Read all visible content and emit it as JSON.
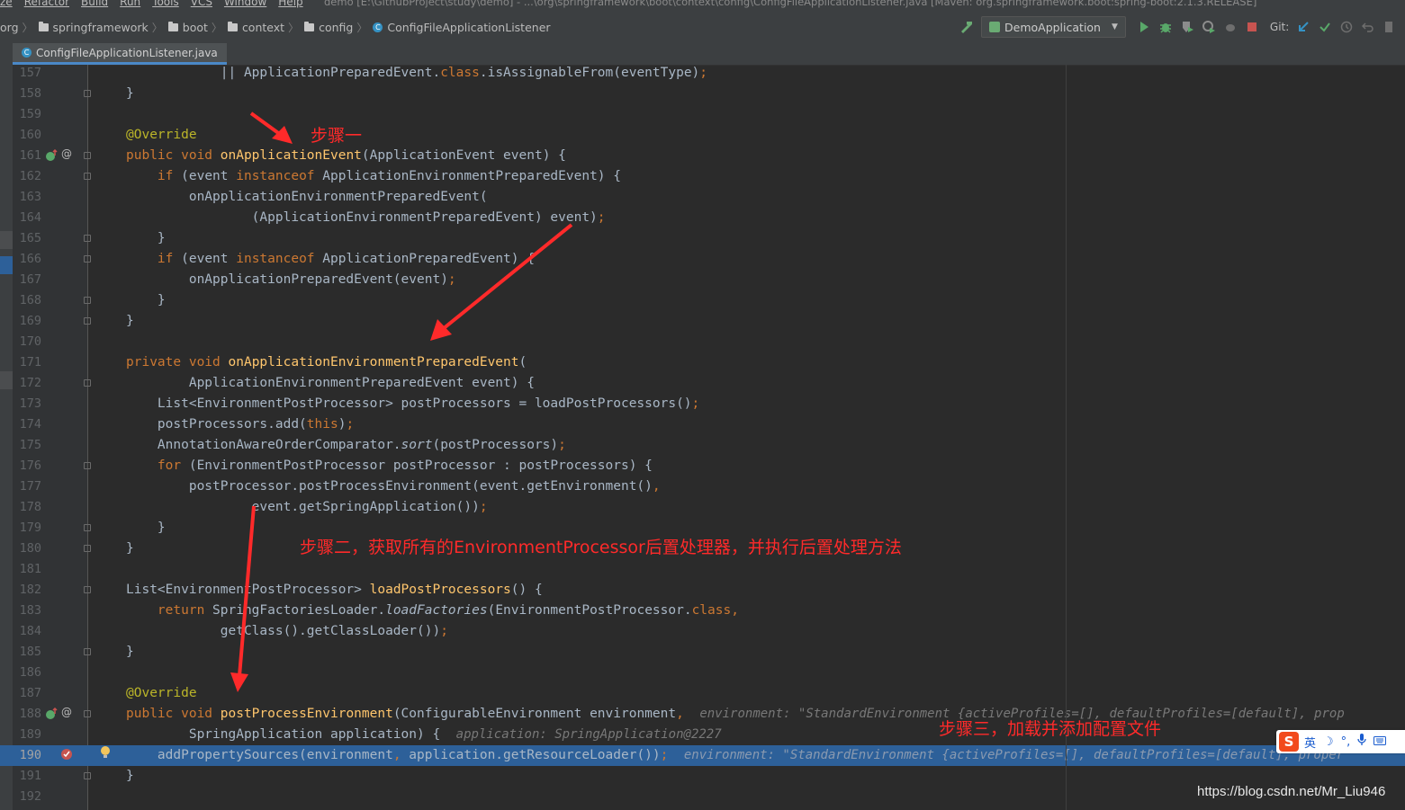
{
  "menu": {
    "items": [
      "ze",
      "Refactor",
      "Build",
      "Run",
      "Tools",
      "VCS",
      "Window",
      "Help"
    ],
    "window_title": "demo [E:\\GithubProject\\study\\demo] - ...\\org\\springframework\\boot\\context\\config\\ConfigFileApplicationListener.java [Maven: org.springframework.boot:spring-boot:2.1.3.RELEASE]"
  },
  "breadcrumb": [
    "org",
    "springframework",
    "boot",
    "context",
    "config",
    "ConfigFileApplicationListener"
  ],
  "toolbar": {
    "run_config": "DemoApplication",
    "git_label": "Git:"
  },
  "tab": {
    "label": "ConfigFileApplicationListener.java"
  },
  "code_lines": [
    {
      "n": "157",
      "html": "            <span>|| ApplicationPreparedEvent.</span><span class='k'>class</span>.isAssignableFrom(eventType)<span class='k'>;</span>"
    },
    {
      "n": "158",
      "html": "}"
    },
    {
      "n": "159",
      "html": ""
    },
    {
      "n": "160",
      "html": "<span class='a'>@Override</span>"
    },
    {
      "n": "161",
      "html": "<span class='k'>public void </span><span class='m'>onApplicationEvent</span>(ApplicationEvent event) {"
    },
    {
      "n": "162",
      "html": "    <span class='k'>if </span>(event <span class='k'>instanceof </span>ApplicationEnvironmentPreparedEvent) {"
    },
    {
      "n": "163",
      "html": "        onApplicationEnvironmentPreparedEvent("
    },
    {
      "n": "164",
      "html": "                (ApplicationEnvironmentPreparedEvent) event)<span class='k'>;</span>"
    },
    {
      "n": "165",
      "html": "    }"
    },
    {
      "n": "166",
      "html": "    <span class='k'>if </span>(event <span class='k'>instanceof </span>ApplicationPreparedEvent) {"
    },
    {
      "n": "167",
      "html": "        onApplicationPreparedEvent(event)<span class='k'>;</span>"
    },
    {
      "n": "168",
      "html": "    }"
    },
    {
      "n": "169",
      "html": "}"
    },
    {
      "n": "170",
      "html": ""
    },
    {
      "n": "171",
      "html": "<span class='k'>private void </span><span class='m'>onApplicationEnvironmentPreparedEvent</span>("
    },
    {
      "n": "172",
      "html": "        ApplicationEnvironmentPreparedEvent event) {"
    },
    {
      "n": "173",
      "html": "    List&lt;EnvironmentPostProcessor&gt; postProcessors = loadPostProcessors()<span class='k'>;</span>"
    },
    {
      "n": "174",
      "html": "    postProcessors.add(<span class='k'>this</span>)<span class='k'>;</span>"
    },
    {
      "n": "175",
      "html": "    AnnotationAwareOrderComparator.<span class='i'>sort</span>(postProcessors)<span class='k'>;</span>"
    },
    {
      "n": "176",
      "html": "    <span class='k'>for </span>(EnvironmentPostProcessor postProcessor : postProcessors) {"
    },
    {
      "n": "177",
      "html": "        postProcessor.postProcessEnvironment(event.getEnvironment()<span class='k'>,</span>"
    },
    {
      "n": "178",
      "html": "                event.getSpringApplication())<span class='k'>;</span>"
    },
    {
      "n": "179",
      "html": "    }"
    },
    {
      "n": "180",
      "html": "}"
    },
    {
      "n": "181",
      "html": ""
    },
    {
      "n": "182",
      "html": "List&lt;EnvironmentPostProcessor&gt; <span class='m'>loadPostProcessors</span>() {"
    },
    {
      "n": "183",
      "html": "    <span class='k'>return </span>SpringFactoriesLoader.<span class='i'>loadFactories</span>(EnvironmentPostProcessor.<span class='k'>class,</span>"
    },
    {
      "n": "184",
      "html": "            getClass().getClassLoader())<span class='k'>;</span>"
    },
    {
      "n": "185",
      "html": "}"
    },
    {
      "n": "186",
      "html": ""
    },
    {
      "n": "187",
      "html": "<span class='a'>@Override</span>"
    },
    {
      "n": "188",
      "html": "<span class='k'>public void </span><span class='m'>postProcessEnvironment</span>(ConfigurableEnvironment environment<span class='k'>,</span>  <span class='hint'>environment: \"StandardEnvironment {activeProfiles=[], defaultProfiles=[default], prop</span>"
    },
    {
      "n": "189",
      "html": "        SpringApplication application) {  <span class='hint'>application: SpringApplication@2227</span>"
    },
    {
      "n": "190",
      "html": "    addPropertySources(environment<span class='k'>, </span>application.getResourceLoader())<span class='k'>;</span>  <span class='hint'>environment: \"StandardEnvironment {activeProfiles=[], defaultProfiles=[default], proper</span>"
    },
    {
      "n": "191",
      "html": "}"
    },
    {
      "n": "192",
      "html": ""
    }
  ],
  "annotations": {
    "step1": "步骤一",
    "step2": "步骤二，获取所有的EnvironmentProcessor后置处理器，并执行后置处理方法",
    "step3": "步骤三，加载并添加配置文件"
  },
  "watermark": "https://blog.csdn.net/Mr_Liu946",
  "ime": {
    "logo": "S",
    "lang": "英"
  },
  "colors": {
    "accent_arrow": "#ff2a2a",
    "current_line": "#2d6099",
    "editor_bg": "#2b2b2b"
  }
}
